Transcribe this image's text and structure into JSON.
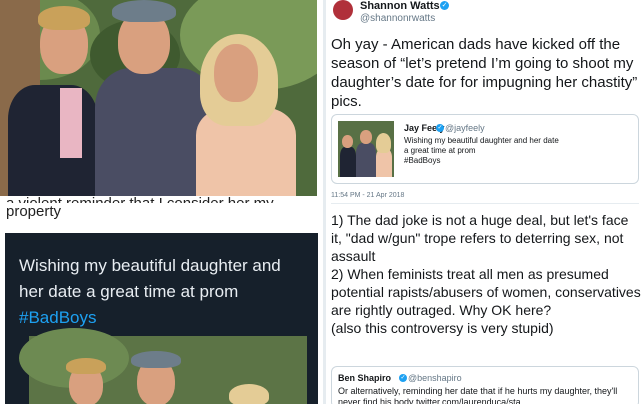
{
  "caption": {
    "line1": "a violent reminder that I consider her my",
    "line2": "property"
  },
  "dark_tweet": {
    "text": "Wishing my beautiful daughter and her date a great time at prom",
    "hashtag": "#BadBoys"
  },
  "shannon_tweet": {
    "name": "Shannon Watts",
    "handle": "@shannonrwatts",
    "text": "Oh yay - American dads have kicked off the season of “let’s pretend I’m going to shoot my daughter’s date for for impugning her chastity” pics.",
    "timestamp": "11:54 PM - 21 Apr 2018"
  },
  "jay_quote": {
    "name": "Jay Feely",
    "handle": "@jayfeely",
    "text": "Wishing my beautiful daughter and her date a great time at prom",
    "hashtag": "#BadBoys"
  },
  "shapiro_comment": {
    "point1": "1) The dad joke is not a huge deal, but let's face it, \"dad w/gun\" trope refers to deterring sex, not assault",
    "point2": "2) When feminists treat all men as presumed potential rapists/abusers of women, conservatives are rightly outraged. Why OK here?",
    "aside": "(also this controversy is very stupid)"
  },
  "shapiro_quote": {
    "name": "Ben Shapiro",
    "handle": "@benshapiro",
    "text": "Or alternatively, reminding her date that if he hurts my daughter, they'll never find his body twitter.com/laurenduca/sta..."
  },
  "icons": {
    "verified": "verified-badge-icon"
  },
  "colors": {
    "twitter_blue": "#1da1f2",
    "dark_tweet_bg": "#16202b"
  }
}
